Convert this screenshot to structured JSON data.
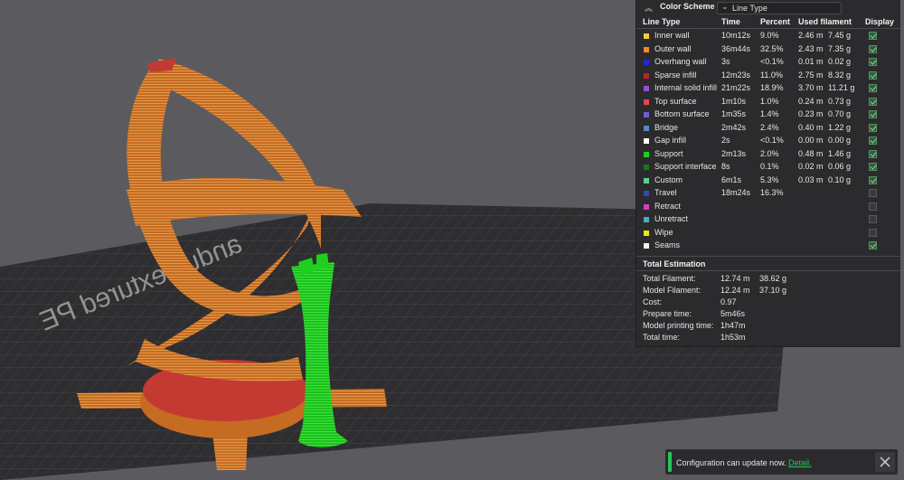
{
  "legend": {
    "title": "Color Scheme",
    "scheme_value": "Line Type",
    "headers": {
      "line_type": "Line Type",
      "time": "Time",
      "percent": "Percent",
      "used_filament": "Used filament",
      "display": "Display"
    },
    "rows": [
      {
        "name": "Inner wall",
        "time": "10m12s",
        "percent": "9.0%",
        "length": "2.46 m",
        "weight": "7.45 g",
        "color": "#f7c844",
        "display": true
      },
      {
        "name": "Outer wall",
        "time": "36m44s",
        "percent": "32.5%",
        "length": "2.43 m",
        "weight": "7.35 g",
        "color": "#ef8a2b",
        "display": true
      },
      {
        "name": "Overhang wall",
        "time": "3s",
        "percent": "<0.1%",
        "length": "0.01 m",
        "weight": "0.02 g",
        "color": "#2626d9",
        "display": true
      },
      {
        "name": "Sparse infill",
        "time": "12m23s",
        "percent": "11.0%",
        "length": "2.75 m",
        "weight": "8.32 g",
        "color": "#b02a2a",
        "display": true
      },
      {
        "name": "Internal solid infill",
        "time": "21m22s",
        "percent": "18.9%",
        "length": "3.70 m",
        "weight": "11.21 g",
        "color": "#9a4fc9",
        "display": true
      },
      {
        "name": "Top surface",
        "time": "1m10s",
        "percent": "1.0%",
        "length": "0.24 m",
        "weight": "0.73 g",
        "color": "#e8474a",
        "display": true
      },
      {
        "name": "Bottom surface",
        "time": "1m35s",
        "percent": "1.4%",
        "length": "0.23 m",
        "weight": "0.70 g",
        "color": "#6e5fd0",
        "display": true
      },
      {
        "name": "Bridge",
        "time": "2m42s",
        "percent": "2.4%",
        "length": "0.40 m",
        "weight": "1.22 g",
        "color": "#5b87c8",
        "display": true
      },
      {
        "name": "Gap infill",
        "time": "2s",
        "percent": "<0.1%",
        "length": "0.00 m",
        "weight": "0.00 g",
        "color": "#ffffff",
        "display": true
      },
      {
        "name": "Support",
        "time": "2m13s",
        "percent": "2.0%",
        "length": "0.48 m",
        "weight": "1.46 g",
        "color": "#1fcf1f",
        "display": true
      },
      {
        "name": "Support interface",
        "time": "8s",
        "percent": "0.1%",
        "length": "0.02 m",
        "weight": "0.06 g",
        "color": "#157a15",
        "display": true
      },
      {
        "name": "Custom",
        "time": "6m1s",
        "percent": "5.3%",
        "length": "0.03 m",
        "weight": "0.10 g",
        "color": "#5fd08c",
        "display": true
      },
      {
        "name": "Travel",
        "time": "18m24s",
        "percent": "16.3%",
        "length": "",
        "weight": "",
        "color": "#3a4aa3",
        "display": false
      },
      {
        "name": "Retract",
        "time": "",
        "percent": "",
        "length": "",
        "weight": "",
        "color": "#d63fc4",
        "display": false
      },
      {
        "name": "Unretract",
        "time": "",
        "percent": "",
        "length": "",
        "weight": "",
        "color": "#4fa7c8",
        "display": false
      },
      {
        "name": "Wipe",
        "time": "",
        "percent": "",
        "length": "",
        "weight": "",
        "color": "#f2e31a",
        "display": false
      },
      {
        "name": "Seams",
        "time": "",
        "percent": "",
        "length": "",
        "weight": "",
        "color": "#f2f2f2",
        "display": true
      }
    ],
    "estimation": {
      "title": "Total Estimation",
      "rows": [
        {
          "label": "Total Filament:",
          "v1": "12.74 m",
          "v2": "38.62 g"
        },
        {
          "label": "Model Filament:",
          "v1": "12.24 m",
          "v2": "37.10 g"
        },
        {
          "label": "Cost:",
          "v1": "0.97",
          "v2": ""
        },
        {
          "label": "Prepare time:",
          "v1": "5m46s",
          "v2": ""
        },
        {
          "label": "Model printing time:",
          "v1": "1h47m",
          "v2": ""
        },
        {
          "label": "Total time:",
          "v1": "1h53m",
          "v2": ""
        }
      ]
    }
  },
  "notification": {
    "message": "Configuration can update now.",
    "link": "Detail."
  },
  "bed_label": "andu Textured PE"
}
